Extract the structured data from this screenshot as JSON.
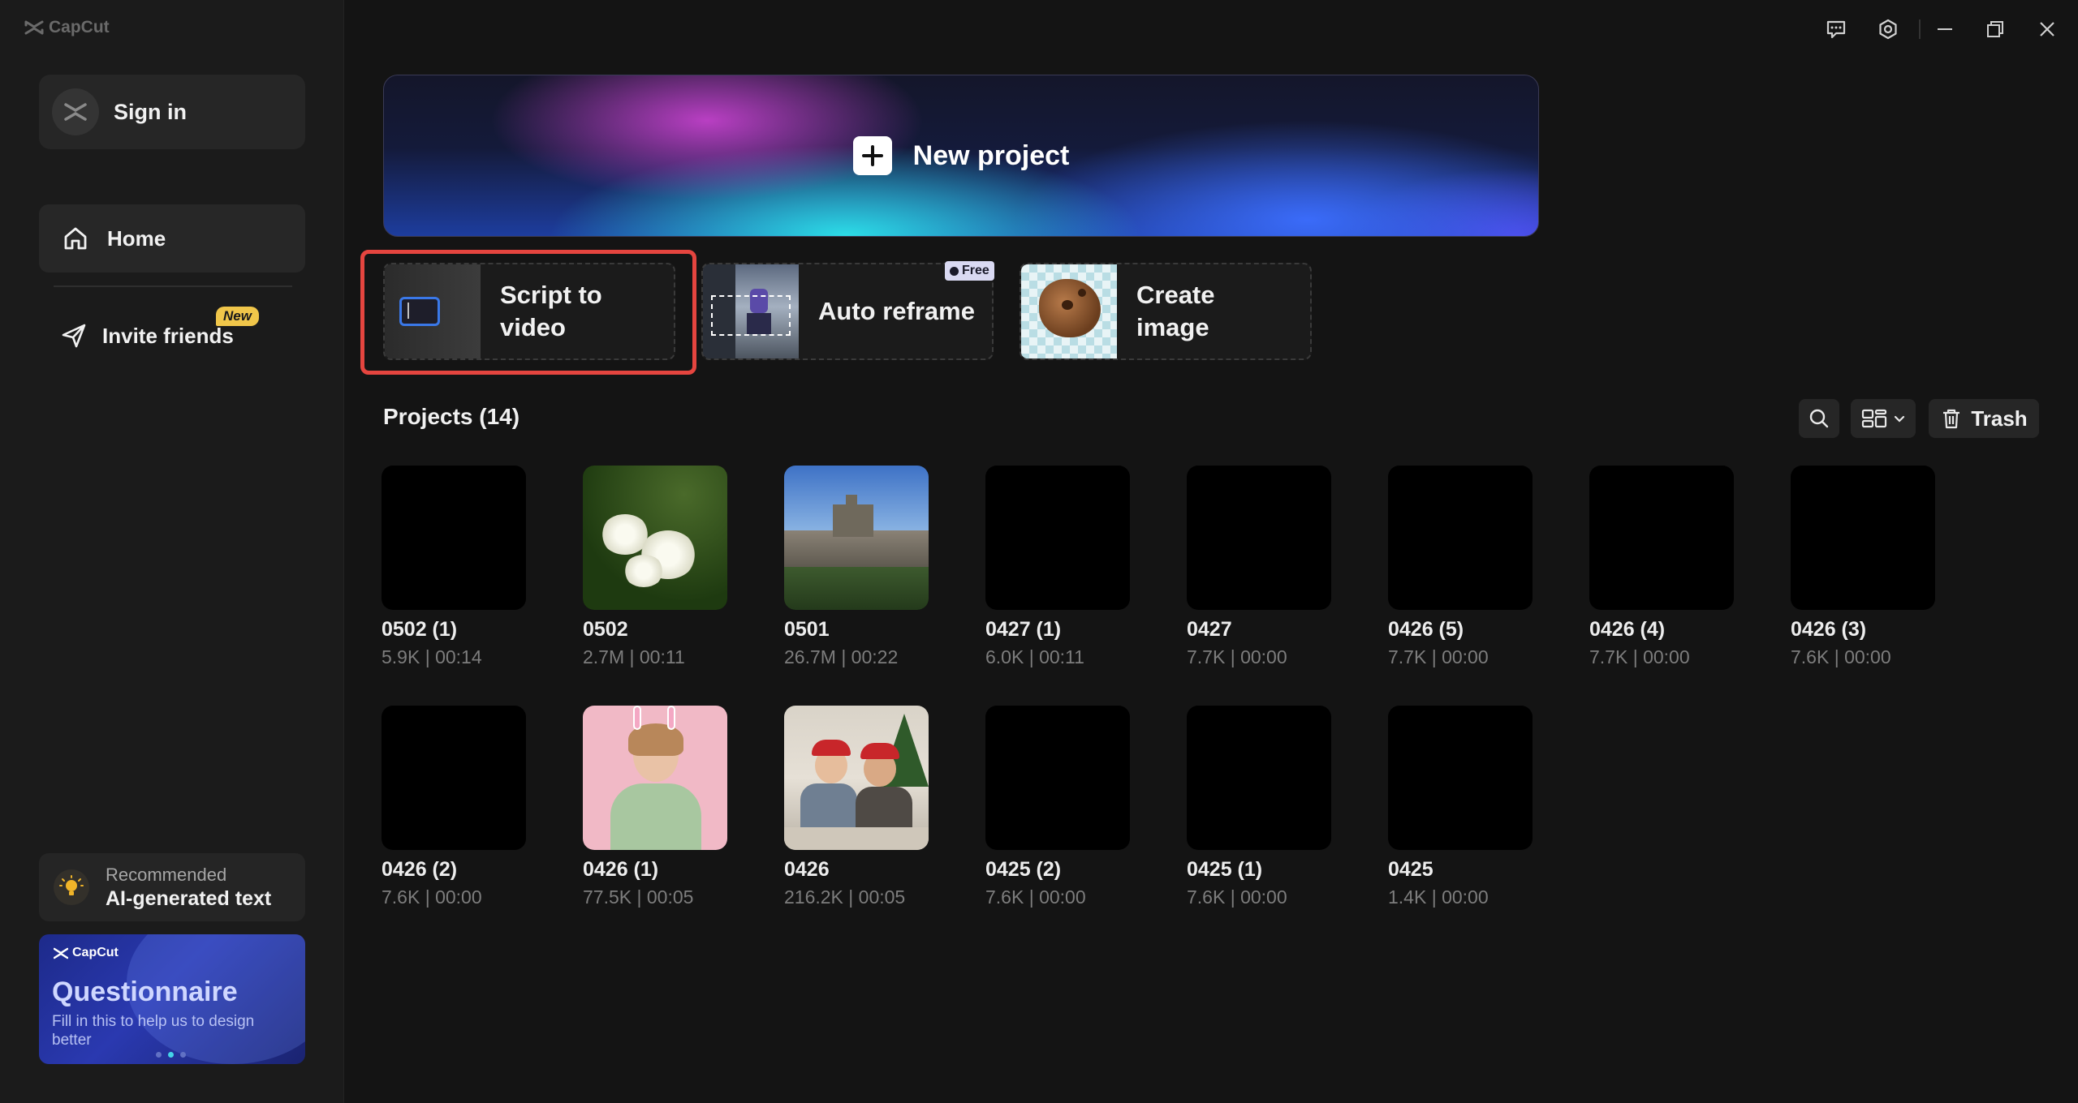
{
  "app": {
    "name": "CapCut"
  },
  "sidebar": {
    "sign_in": "Sign in",
    "home": "Home",
    "invite": "Invite friends",
    "invite_badge": "New",
    "recommended_small": "Recommended",
    "recommended_big": "AI-generated text",
    "questionnaire": {
      "brand": "CapCut",
      "title": "Questionnaire",
      "subtitle": "Fill in this to help us to design better"
    }
  },
  "main": {
    "new_project": "New project",
    "tools": [
      {
        "label_line1": "Script to",
        "label_line2": "video"
      },
      {
        "label": "Auto reframe",
        "badge": "Free"
      },
      {
        "label_line1": "Create",
        "label_line2": "image"
      }
    ],
    "projects_title": "Projects  (14)",
    "trash": "Trash",
    "projects": [
      {
        "name": "0502 (1)",
        "meta": "5.9K | 00:14"
      },
      {
        "name": "0502",
        "meta": "2.7M | 00:11"
      },
      {
        "name": "0501",
        "meta": "26.7M | 00:22"
      },
      {
        "name": "0427 (1)",
        "meta": "6.0K | 00:11"
      },
      {
        "name": "0427",
        "meta": "7.7K | 00:00"
      },
      {
        "name": "0426 (5)",
        "meta": "7.7K | 00:00"
      },
      {
        "name": "0426 (4)",
        "meta": "7.7K | 00:00"
      },
      {
        "name": "0426 (3)",
        "meta": "7.6K | 00:00"
      },
      {
        "name": "0426 (2)",
        "meta": "7.6K | 00:00"
      },
      {
        "name": "0426 (1)",
        "meta": "77.5K | 00:05"
      },
      {
        "name": "0426",
        "meta": "216.2K | 00:05"
      },
      {
        "name": "0425 (2)",
        "meta": "7.6K | 00:00"
      },
      {
        "name": "0425 (1)",
        "meta": "7.6K | 00:00"
      },
      {
        "name": "0425",
        "meta": "1.4K | 00:00"
      }
    ]
  },
  "colors": {
    "background": "#141414",
    "sidebar": "#1b1b1b",
    "highlight": "#e5453f",
    "new_badge": "#f0c64a"
  }
}
